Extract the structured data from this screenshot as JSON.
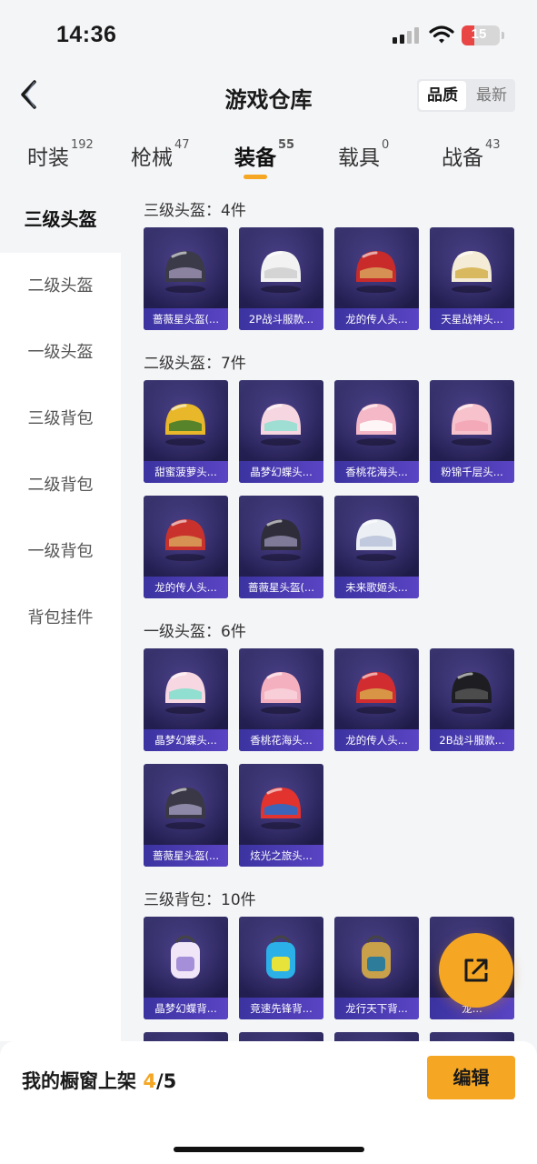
{
  "status": {
    "time": "14:36",
    "battery": "15"
  },
  "header": {
    "title": "游戏仓库",
    "sort_quality": "品质",
    "sort_latest": "最新"
  },
  "tabs": [
    {
      "label": "时装",
      "count": "192"
    },
    {
      "label": "枪械",
      "count": "47"
    },
    {
      "label": "装备",
      "count": "55"
    },
    {
      "label": "载具",
      "count": "0"
    },
    {
      "label": "战备",
      "count": "43"
    }
  ],
  "sidebar": {
    "items": [
      "三级头盔",
      "二级头盔",
      "一级头盔",
      "三级背包",
      "二级背包",
      "一级背包",
      "背包挂件"
    ]
  },
  "sections": [
    {
      "title": "三级头盔：4件",
      "items": [
        "蔷薇星头盔(...",
        "2P战斗服款...",
        "龙的传人头...",
        "天星战神头..."
      ]
    },
    {
      "title": "二级头盔：7件",
      "items": [
        "甜蜜菠萝头...",
        "晶梦幻蝶头...",
        "香桃花海头...",
        "粉锦千层头...",
        "龙的传人头...",
        "蔷薇星头盔(...",
        "未来歌姬头..."
      ]
    },
    {
      "title": "一级头盔：6件",
      "items": [
        "晶梦幻蝶头...",
        "香桃花海头...",
        "龙的传人头...",
        "2B战斗服款...",
        "蔷薇星头盔(...",
        "炫光之旅头..."
      ]
    },
    {
      "title": "三级背包：10件",
      "items": [
        "晶梦幻蝶背...",
        "竞速先锋背...",
        "龙行天下背...",
        "龙..."
      ]
    }
  ],
  "bottom": {
    "showcase_label": "我的橱窗上架",
    "showcase_current": "4",
    "showcase_total": "/5",
    "edit_label": "编辑"
  },
  "colors": {
    "accent": "#f5a623",
    "card_bg": "#231f52",
    "card_label": "#4a3cb5"
  }
}
